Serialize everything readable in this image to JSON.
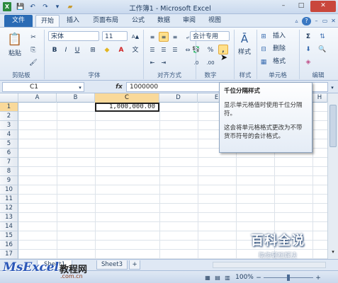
{
  "window": {
    "title": "工作簿1 - Microsoft Excel",
    "min": "–",
    "max": "□",
    "close": "✕",
    "restore": "▭"
  },
  "qat": {
    "save": "💾",
    "undo": "↶",
    "redo": "↷",
    "more": "▾"
  },
  "tabs": [
    {
      "label": "文件"
    },
    {
      "label": "开始"
    },
    {
      "label": "插入"
    },
    {
      "label": "页面布局"
    },
    {
      "label": "公式"
    },
    {
      "label": "数据"
    },
    {
      "label": "审阅"
    },
    {
      "label": "视图"
    }
  ],
  "ribbon": {
    "clipboard": {
      "label": "剪贴板",
      "paste": "粘贴",
      "cut": "✂",
      "copy": "⎘",
      "format_painter": "🖌"
    },
    "font": {
      "label": "字体",
      "name": "宋体",
      "size": "11",
      "bold": "B",
      "italic": "I",
      "underline": "U",
      "grow": "A▲",
      "shrink": "A▼",
      "border": "⊞",
      "fill": "◆",
      "color": "A",
      "wen": "文"
    },
    "alignment": {
      "label": "对齐方式"
    },
    "number": {
      "label": "数字",
      "format": "会计专用",
      "percent": "%",
      "comma": ","
    },
    "styles": {
      "label": "样式",
      "button": "样式"
    },
    "cells": {
      "label": "单元格",
      "insert": "插入",
      "delete": "删除",
      "format": "格式"
    },
    "editing": {
      "label": "编辑",
      "sum": "Σ",
      "fill": "⬇",
      "clear": "◈"
    }
  },
  "formula_bar": {
    "name_box": "C1",
    "fx": "fx",
    "value": "1000000"
  },
  "grid": {
    "columns": [
      "A",
      "B",
      "C",
      "D",
      "E",
      "F",
      "G",
      "H"
    ],
    "rows": [
      "1",
      "2",
      "3",
      "4",
      "5",
      "6",
      "7",
      "8",
      "9",
      "10",
      "11",
      "12",
      "13",
      "14",
      "15",
      "16",
      "17"
    ],
    "selected_column": "C",
    "selected_row": "1",
    "cell_c1": "1,000,000.00"
  },
  "tooltip": {
    "title": "千位分隔样式",
    "line1": "显示单元格值时使用千位分隔符。",
    "line2": "这会将单元格格式更改为不带货币符号的会计格式。"
  },
  "sheets": {
    "sheet1": "Sheet1",
    "sheet3": "Sheet3"
  },
  "status": {
    "zoom": "100%",
    "zoom_out": "−",
    "zoom_in": "+"
  },
  "watermarks": {
    "left_main": "MsExcel",
    "left_cn": "教程网",
    "left_domain": ".com.cn",
    "right_main": "百科全说",
    "right_sub": "助你轻松解决"
  }
}
